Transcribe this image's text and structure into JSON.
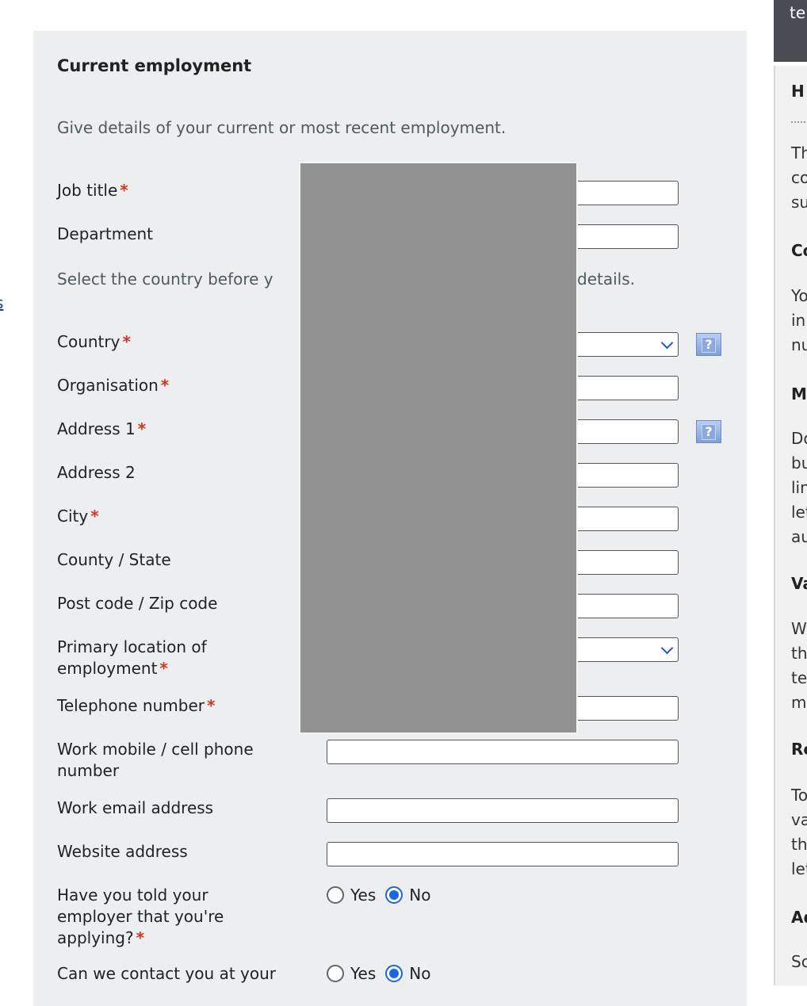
{
  "left_link": {
    "text": "s"
  },
  "section": {
    "title": "Current employment",
    "intro": "Give details of your current or most recent employment.",
    "hint": "Select the country before y",
    "hint_tail": "details."
  },
  "fields": {
    "job_title": "Job title",
    "department": "Department",
    "country": "Country",
    "organisation": "Organisation",
    "address1": "Address 1",
    "address2": "Address 2",
    "city": "City",
    "county": "County / State",
    "postcode": "Post code / Zip code",
    "primary_location": "Primary location of employment",
    "telephone": "Telephone number",
    "work_mobile": "Work mobile / cell phone number",
    "work_email": "Work email address",
    "website": "Website address",
    "told_employer": "Have you told your employer that you're applying?",
    "contact_at_work": "Can we contact you at your"
  },
  "required_marker": "*",
  "help_icon": "?",
  "radio": {
    "yes": "Yes",
    "no": "No"
  },
  "right_panel": {
    "top": "te",
    "lines": [
      "H",
      "Th",
      "co",
      "su",
      "Co",
      "Yo",
      "in",
      "nu",
      "M",
      "Do",
      "bu",
      "lin",
      "let",
      "au",
      "Va",
      "W",
      "th",
      "te",
      "m",
      "Re",
      "To",
      "va",
      "th",
      "let",
      "Ad",
      "Sc"
    ]
  }
}
